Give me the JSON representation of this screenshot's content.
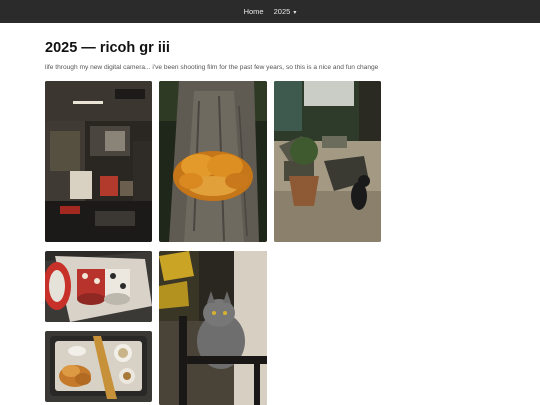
{
  "nav": {
    "home_label": "Home",
    "year_label": "2025",
    "caret": "▾"
  },
  "page": {
    "title": "2025 — ricoh gr iii",
    "subtitle": "life through my new digital camera... i've been shooting film for the past few years, so this is a nice and fun change"
  },
  "photos": [
    {
      "subject": "workshop"
    },
    {
      "subject": "tree-fungus"
    },
    {
      "subject": "garden-cat"
    },
    {
      "subject": "mugs"
    },
    {
      "subject": "grey-cat"
    },
    {
      "subject": "breakfast"
    }
  ]
}
